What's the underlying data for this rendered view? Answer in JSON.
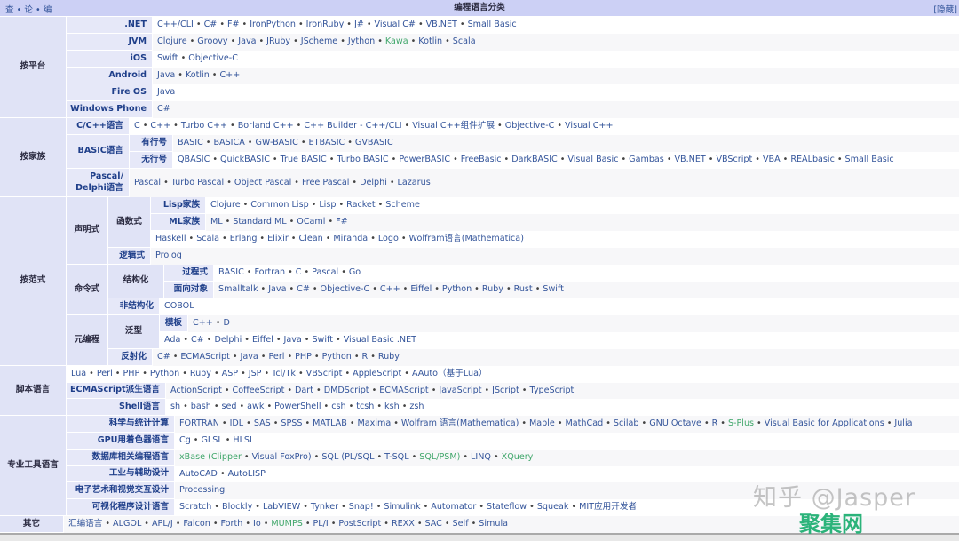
{
  "header": {
    "title": "编程语言分类",
    "vte": "查 • 论 • 编",
    "hide": "[隐藏]"
  },
  "green_items": [
    "Kawa",
    "S-Plus",
    "xBase",
    "SQL/PSM",
    "XQuery",
    "MUMPS"
  ],
  "cells": {
    "g_platform": "按平台",
    "l_net": ".NET",
    "i_net": "C++/CLI • C# • F# • IronPython • IronRuby • J# • Visual C# • VB.NET • Small Basic",
    "l_jvm": "JVM",
    "i_jvm": "Clojure • Groovy • Java • JRuby • JScheme • Jython • Kawa • Kotlin • Scala",
    "l_ios": "iOS",
    "i_ios": "Swift • Objective-C",
    "l_android": "Android",
    "i_android": "Java • Kotlin • C++",
    "l_fireos": "Fire OS",
    "i_fireos": "Java",
    "l_wp": "Windows Phone",
    "i_wp": "C#",
    "g_family": "按家族",
    "l_c": "C/C++语言",
    "i_c": "C • C++ • Turbo C++ • Borland C++ • C++ Builder - C++/CLI • Visual C++组件扩展 • Objective-C • Visual C++",
    "l_basic": "BASIC语言",
    "l_lined": "有行号",
    "i_lined": "BASIC • BASICA • GW-BASIC • ETBASIC • GVBASIC",
    "l_unlined": "无行号",
    "i_unlined": "QBASIC • QuickBASIC • True BASIC • Turbo BASIC • PowerBASIC • FreeBasic • DarkBASIC • Visual Basic • Gambas • VB.NET • VBScript • VBA • REALbasic • Small Basic",
    "l_pascal": "Pascal/ Delphi语言",
    "i_pascal": "Pascal • Turbo Pascal • Object Pascal • Free Pascal • Delphi • Lazarus",
    "g_paradigm": "按范式",
    "g_declarative": "声明式",
    "g_functional": "函数式",
    "l_lisp": "Lisp家族",
    "i_lisp": "Clojure • Common Lisp • Lisp • Racket • Scheme",
    "l_ml": "ML家族",
    "i_ml": "ML • Standard ML • OCaml • F#",
    "i_func_other": "Haskell • Scala • Erlang • Elixir • Clean • Miranda • Logo • Wolfram语言(Mathematica)",
    "l_logic": "逻辑式",
    "i_logic": "Prolog",
    "g_imperative": "命令式",
    "g_structured": "结构化",
    "l_procedural": "过程式",
    "i_procedural": "BASIC • Fortran • C • Pascal • Go",
    "l_oop": "面向对象",
    "i_oop": "Smalltalk • Java • C# • Objective-C • C++ • Eiffel • Python • Ruby • Rust • Swift",
    "l_unstructured": "非结构化",
    "i_unstructured": "COBOL",
    "g_meta": "元编程",
    "g_generic": "泛型",
    "l_template": "模板",
    "i_template": "C++ • D",
    "i_generic_other": "Ada • C# • Delphi • Eiffel • Java • Swift • Visual Basic .NET",
    "l_reflective": "反射化",
    "i_reflective": "C# • ECMAScript • Java • Perl • PHP • Python • R • Ruby",
    "g_script": "脚本语言",
    "i_script": "Lua • Perl • PHP • Python • Ruby • ASP • JSP • Tcl/Tk • VBScript • AppleScript • AAuto（基于Lua）",
    "l_ecma": "ECMAScript派生语言",
    "i_ecma": "ActionScript • CoffeeScript • Dart • DMDScript • ECMAScript • JavaScript • JScript • TypeScript",
    "l_shell": "Shell语言",
    "i_shell": "sh • bash • sed • awk • PowerShell • csh • tcsh • ksh • zsh",
    "g_tools": "专业工具语言",
    "l_sci": "科学与统计计算",
    "i_sci": "FORTRAN • IDL • SAS • SPSS • MATLAB • Maxima • Wolfram 语言(Mathematica) • Maple • MathCad • Scilab • GNU Octave • R • S-Plus • Visual Basic for Applications • Julia",
    "l_gpu": "GPU用着色器语言",
    "i_gpu": "Cg • GLSL • HLSL",
    "l_db": "数据库相关编程语言",
    "i_db": "xBase (Clipper • Visual FoxPro) • SQL (PL/SQL • T-SQL • SQL/PSM) • LINQ • XQuery",
    "l_cad": "工业与辅助设计",
    "i_cad": "AutoCAD • AutoLISP",
    "l_art": "电子艺术和视觉交互设计",
    "i_art": "Processing",
    "l_visual": "可视化程序设计语言",
    "i_visual": "Scratch • Blockly • LabVIEW • Tynker • Snap! • Simulink • Automator • Stateflow • Squeak • MIT应用开发者",
    "g_other": "其它",
    "i_other": "汇编语言 • ALGOL • APL/J • Falcon • Forth • Io • MUMPS • PL/I • PostScript • REXX • SAC • Self • Simula"
  },
  "watermark": {
    "zhihu": "知乎 @Jasper",
    "site": "聚集网"
  }
}
